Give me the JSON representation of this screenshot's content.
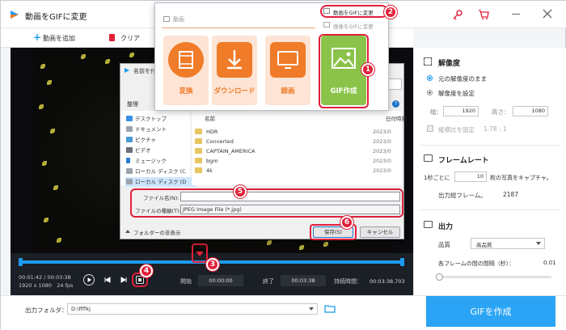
{
  "window": {
    "title": "動画をGIFに変更"
  },
  "toolbar": {
    "add_video": "動画を追加",
    "clear": "クリア"
  },
  "menu": {
    "section_label": "動画",
    "items": [
      "動画をGIFに変更",
      "画像をGIFに変更"
    ],
    "tiles": [
      "変換",
      "ダウンロード",
      "録画",
      "GIF作成"
    ]
  },
  "dialog": {
    "title": "名前を付",
    "organize": "整理",
    "sidebar": [
      "デスクトップ",
      "ドキュメント",
      "ピクチャ",
      "ビデオ",
      "ミュージック",
      "ローカル ディスク (C",
      "ローカル ディスク (D"
    ],
    "col_name": "名前",
    "col_date": "日付時刻",
    "files": [
      {
        "name": "HDR",
        "date": "2023/0"
      },
      {
        "name": "Converted",
        "date": "2023/0"
      },
      {
        "name": "CAPTAIN_AMERICA",
        "date": "2023/0"
      },
      {
        "name": "bgm",
        "date": "2023/0"
      },
      {
        "name": "4k",
        "date": "2023/0"
      }
    ],
    "filename_label": "ファイル名(N):",
    "filename_value": "",
    "filetype_label": "ファイルの種類(T):",
    "filetype_value": "JPEG Image File (*.jpg)",
    "hide_folders": "フォルダーの非表示",
    "save": "保存(S)",
    "cancel": "キャンセル"
  },
  "badges": [
    "1",
    "2",
    "3",
    "4",
    "5",
    "6"
  ],
  "timeline": {
    "current": "00:01:42",
    "total": "00:03:38",
    "resolution": "1920 x 1080",
    "fps": "24 fps",
    "start_label": "開始",
    "start_value": "00:00:00",
    "end_label": "終了",
    "end_value": "00:03:38",
    "duration_label": "持続時間：",
    "duration_value": "00:03:38.703"
  },
  "panel": {
    "resolution_title": "解像度",
    "keep_original": "元の解像度のまま",
    "set_resolution": "解像度を設定",
    "width_label": "幅：",
    "width_value": "1920",
    "height_label": "高さ：",
    "height_value": "1080",
    "aspect_label": "縦横比を固定",
    "aspect_value": "1.78 : 1",
    "framerate_title": "フレームレート",
    "per_sec_prefix": "1秒ごとに",
    "per_sec_value": "10",
    "per_sec_suffix": "枚の写真をキャプチャ。",
    "output_frames_label": "出力総フレーム。",
    "output_frames_value": "2187",
    "output_title": "出力",
    "quality_label": "品質",
    "quality_value": "高品質",
    "interval_label": "各フレームの間の間隔（秒）：",
    "interval_value": "0.01"
  },
  "bottom": {
    "output_folder_label": "出力フォルダ：",
    "output_folder_value": "D:\\ffffkj",
    "create_button": "GIFを作成"
  },
  "colors": {
    "accent": "#1d9bf0",
    "orange": "#f07b28",
    "green": "#8bc34a",
    "highlight": "#e0203a"
  }
}
